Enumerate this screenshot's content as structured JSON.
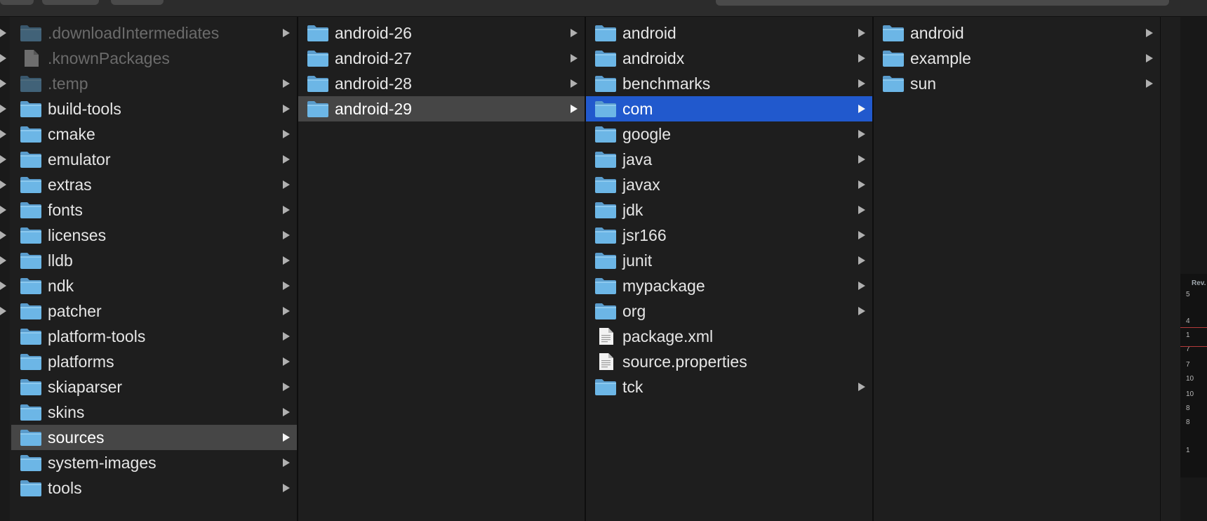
{
  "columns": [
    {
      "items": [
        {
          "label": ".downloadIntermediates",
          "type": "folder",
          "dim": true,
          "chevron": true
        },
        {
          "label": ".knownPackages",
          "type": "file",
          "dim": true,
          "chevron": false
        },
        {
          "label": ".temp",
          "type": "folder",
          "dim": true,
          "chevron": true
        },
        {
          "label": "build-tools",
          "type": "folder",
          "chevron": true
        },
        {
          "label": "cmake",
          "type": "folder",
          "chevron": true
        },
        {
          "label": "emulator",
          "type": "folder",
          "chevron": true
        },
        {
          "label": "extras",
          "type": "folder",
          "chevron": true
        },
        {
          "label": "fonts",
          "type": "folder",
          "chevron": true
        },
        {
          "label": "licenses",
          "type": "folder",
          "chevron": true
        },
        {
          "label": "lldb",
          "type": "folder",
          "chevron": true
        },
        {
          "label": "ndk",
          "type": "folder",
          "chevron": true
        },
        {
          "label": "patcher",
          "type": "folder",
          "chevron": true
        },
        {
          "label": "platform-tools",
          "type": "folder",
          "chevron": true
        },
        {
          "label": "platforms",
          "type": "folder",
          "chevron": true
        },
        {
          "label": "skiaparser",
          "type": "folder",
          "chevron": true
        },
        {
          "label": "skins",
          "type": "folder",
          "chevron": true
        },
        {
          "label": "sources",
          "type": "folder",
          "chevron": true,
          "selected": "gray"
        },
        {
          "label": "system-images",
          "type": "folder",
          "chevron": true
        },
        {
          "label": "tools",
          "type": "folder",
          "chevron": true
        }
      ]
    },
    {
      "items": [
        {
          "label": "android-26",
          "type": "folder",
          "chevron": true
        },
        {
          "label": "android-27",
          "type": "folder",
          "chevron": true
        },
        {
          "label": "android-28",
          "type": "folder",
          "chevron": true
        },
        {
          "label": "android-29",
          "type": "folder",
          "chevron": true,
          "selected": "gray"
        }
      ]
    },
    {
      "items": [
        {
          "label": "android",
          "type": "folder",
          "chevron": true
        },
        {
          "label": "androidx",
          "type": "folder",
          "chevron": true
        },
        {
          "label": "benchmarks",
          "type": "folder",
          "chevron": true
        },
        {
          "label": "com",
          "type": "folder",
          "chevron": true,
          "selected": "blue"
        },
        {
          "label": "google",
          "type": "folder",
          "chevron": true
        },
        {
          "label": "java",
          "type": "folder",
          "chevron": true
        },
        {
          "label": "javax",
          "type": "folder",
          "chevron": true
        },
        {
          "label": "jdk",
          "type": "folder",
          "chevron": true
        },
        {
          "label": "jsr166",
          "type": "folder",
          "chevron": true
        },
        {
          "label": "junit",
          "type": "folder",
          "chevron": true
        },
        {
          "label": "mypackage",
          "type": "folder",
          "chevron": true
        },
        {
          "label": "org",
          "type": "folder",
          "chevron": true
        },
        {
          "label": "package.xml",
          "type": "doc",
          "chevron": false
        },
        {
          "label": "source.properties",
          "type": "doc",
          "chevron": false
        },
        {
          "label": "tck",
          "type": "folder",
          "chevron": true
        }
      ]
    },
    {
      "items": [
        {
          "label": "android",
          "type": "folder",
          "chevron": true
        },
        {
          "label": "example",
          "type": "folder",
          "chevron": true
        },
        {
          "label": "sun",
          "type": "folder",
          "chevron": true
        }
      ]
    }
  ],
  "side_panel": {
    "header": "Rev.",
    "numbers": [
      "5",
      "4",
      "1",
      "7",
      "7",
      "10",
      "10",
      "8",
      "8",
      "1"
    ]
  },
  "colors": {
    "background": "#1e1e1e",
    "selected_blue": "#2159cd",
    "selected_gray": "#464646",
    "folder_blue": "#6cb6e6"
  }
}
